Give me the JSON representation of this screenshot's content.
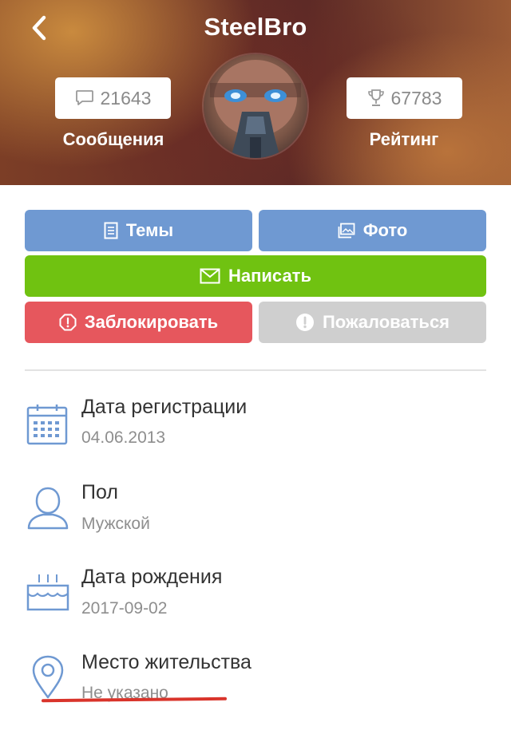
{
  "header": {
    "username": "SteelBro",
    "messages": {
      "count": "21643",
      "label": "Сообщения"
    },
    "rating": {
      "count": "67783",
      "label": "Рейтинг"
    }
  },
  "actions": {
    "topics": "Темы",
    "photo": "Фото",
    "write": "Написать",
    "block": "Заблокировать",
    "report": "Пожаловаться"
  },
  "info": {
    "registration": {
      "title": "Дата регистрации",
      "value": "04.06.2013"
    },
    "gender": {
      "title": "Пол",
      "value": "Мужской"
    },
    "birthday": {
      "title": "Дата рождения",
      "value": "2017-09-02"
    },
    "residence": {
      "title": "Место жительства",
      "value": "Не указано"
    }
  },
  "colors": {
    "blue": "#6f99d2",
    "green": "#70c211",
    "red": "#e6575d",
    "gray": "#cfcfcf",
    "icon_blue": "#6f99d2"
  }
}
